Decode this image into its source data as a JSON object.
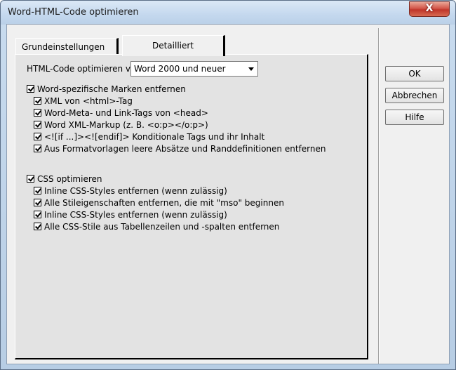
{
  "window": {
    "title": "Word-HTML-Code optimieren",
    "close_label": "X"
  },
  "tabs": [
    {
      "label": "Grundeinstellungen",
      "active": false
    },
    {
      "label": "Detailliert",
      "active": true
    }
  ],
  "optimize_from": {
    "label": "HTML-Code optimieren von",
    "value": "Word 2000 und neuer"
  },
  "word_group": {
    "label": "Word-spezifische Marken entfernen",
    "checked": true,
    "items": [
      {
        "label": "XML von <html>-Tag",
        "checked": true
      },
      {
        "label": "Word-Meta- und Link-Tags von <head>",
        "checked": true
      },
      {
        "label": "Word XML-Markup (z. B. <o:p></o:p>)",
        "checked": true
      },
      {
        "label": "<![if ...]><![endif]> Konditionale Tags und ihr Inhalt",
        "checked": true
      },
      {
        "label": "Aus Formatvorlagen leere Absätze und Randdefinitionen entfernen",
        "checked": true
      }
    ]
  },
  "css_group": {
    "label": "CSS optimieren",
    "checked": true,
    "items": [
      {
        "label": "Inline CSS-Styles entfernen (wenn zulässig)",
        "checked": true
      },
      {
        "label": "Alle Stileigenschaften entfernen, die mit \"mso\" beginnen",
        "checked": true
      },
      {
        "label": "Inline CSS-Styles entfernen (wenn zulässig)",
        "checked": true
      },
      {
        "label": "Alle CSS-Stile aus Tabellenzeilen und -spalten entfernen",
        "checked": true
      }
    ]
  },
  "buttons": {
    "ok": "OK",
    "cancel": "Abbrechen",
    "help": "Hilfe"
  }
}
